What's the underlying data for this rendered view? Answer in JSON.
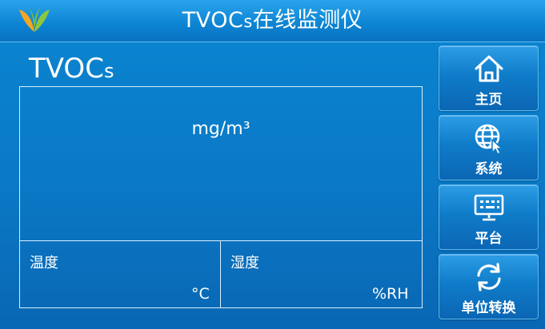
{
  "header": {
    "title_main": "TVOC",
    "title_sub": "s",
    "title_rest": "在线监测仪",
    "logo_icon": "leaf-logo-icon"
  },
  "reading": {
    "gas_main": "TVOC",
    "gas_sub": "s",
    "unit": "mg/m³"
  },
  "env": {
    "temperature_label": "温度",
    "temperature_unit": "°C",
    "humidity_label": "湿度",
    "humidity_unit": "%RH"
  },
  "nav": {
    "home": {
      "label": "主页",
      "icon": "home-icon"
    },
    "system": {
      "label": "系统",
      "icon": "globe-cursor-icon"
    },
    "platform": {
      "label": "平台",
      "icon": "monitor-icon"
    },
    "unit_switch": {
      "label": "单位转换",
      "icon": "refresh-icon"
    }
  },
  "colors": {
    "background": "#0a79c6",
    "titlebar": "#0c83d2",
    "panel_border": "#d9eefc",
    "logo_orange": "#f5a623",
    "logo_green": "#8cc63f",
    "text": "#ffffff"
  }
}
